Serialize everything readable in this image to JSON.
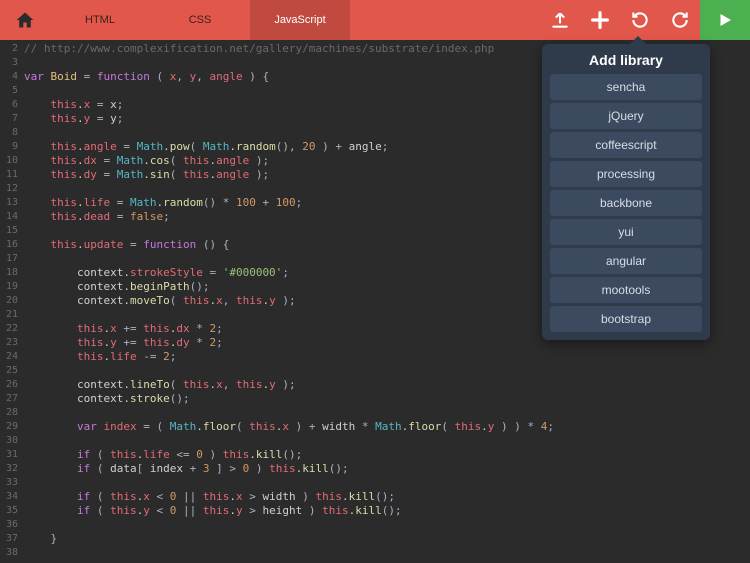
{
  "tabs": {
    "html": "HTML",
    "css": "CSS",
    "js": "JavaScript"
  },
  "popover": {
    "title": "Add library",
    "items": [
      "sencha",
      "jQuery",
      "coffeescript",
      "processing",
      "backbone",
      "yui",
      "angular",
      "mootools",
      "bootstrap"
    ]
  },
  "code": {
    "lines": [
      {
        "n": 2,
        "t": "comment",
        "text": "// http://www.complexification.net/gallery/machines/substrate/index.php"
      },
      {
        "n": 3,
        "t": "blank"
      },
      {
        "n": 4,
        "t": "raw",
        "html": "<span class='c-kw'>var</span> <span class='c-class'>Boid</span> <span class='c-op'>=</span> <span class='c-kw'>function</span> <span class='c-paren'>(</span> <span class='c-prop'>x</span><span class='c-paren'>,</span> <span class='c-prop'>y</span><span class='c-paren'>,</span> <span class='c-prop'>angle</span> <span class='c-paren'>) {</span>"
      },
      {
        "n": 5,
        "t": "blank"
      },
      {
        "n": 6,
        "t": "raw",
        "html": "    <span class='c-this'>this</span>.<span class='c-prop'>x</span> <span class='c-op'>=</span> x<span class='c-paren'>;</span>"
      },
      {
        "n": 7,
        "t": "raw",
        "html": "    <span class='c-this'>this</span>.<span class='c-prop'>y</span> <span class='c-op'>=</span> y<span class='c-paren'>;</span>"
      },
      {
        "n": 8,
        "t": "blank"
      },
      {
        "n": 9,
        "t": "raw",
        "html": "    <span class='c-this'>this</span>.<span class='c-prop'>angle</span> <span class='c-op'>=</span> <span class='c-obj'>Math</span>.<span class='c-func'>pow</span><span class='c-paren'>(</span> <span class='c-obj'>Math</span>.<span class='c-func'>random</span><span class='c-paren'>()</span><span class='c-paren'>,</span> <span class='c-num'>20</span> <span class='c-paren'>)</span> <span class='c-op'>+</span> angle<span class='c-paren'>;</span>"
      },
      {
        "n": 10,
        "t": "raw",
        "html": "    <span class='c-this'>this</span>.<span class='c-prop'>dx</span> <span class='c-op'>=</span> <span class='c-obj'>Math</span>.<span class='c-func'>cos</span><span class='c-paren'>(</span> <span class='c-this'>this</span>.<span class='c-prop'>angle</span> <span class='c-paren'>);</span>"
      },
      {
        "n": 11,
        "t": "raw",
        "html": "    <span class='c-this'>this</span>.<span class='c-prop'>dy</span> <span class='c-op'>=</span> <span class='c-obj'>Math</span>.<span class='c-func'>sin</span><span class='c-paren'>(</span> <span class='c-this'>this</span>.<span class='c-prop'>angle</span> <span class='c-paren'>);</span>"
      },
      {
        "n": 12,
        "t": "blank"
      },
      {
        "n": 13,
        "t": "raw",
        "html": "    <span class='c-this'>this</span>.<span class='c-prop'>life</span> <span class='c-op'>=</span> <span class='c-obj'>Math</span>.<span class='c-func'>random</span><span class='c-paren'>()</span> <span class='c-op'>*</span> <span class='c-num'>100</span> <span class='c-op'>+</span> <span class='c-num'>100</span><span class='c-paren'>;</span>"
      },
      {
        "n": 14,
        "t": "raw",
        "html": "    <span class='c-this'>this</span>.<span class='c-prop'>dead</span> <span class='c-op'>=</span> <span class='c-bool'>false</span><span class='c-paren'>;</span>"
      },
      {
        "n": 15,
        "t": "blank"
      },
      {
        "n": 16,
        "t": "raw",
        "html": "    <span class='c-this'>this</span>.<span class='c-prop'>update</span> <span class='c-op'>=</span> <span class='c-kw'>function</span> <span class='c-paren'>() {</span>"
      },
      {
        "n": 17,
        "t": "blank"
      },
      {
        "n": 18,
        "t": "raw",
        "html": "        context.<span class='c-prop'>strokeStyle</span> <span class='c-op'>=</span> <span class='c-str'>'#000000'</span><span class='c-paren'>;</span>"
      },
      {
        "n": 19,
        "t": "raw",
        "html": "        context.<span class='c-func'>beginPath</span><span class='c-paren'>();</span>"
      },
      {
        "n": 20,
        "t": "raw",
        "html": "        context.<span class='c-func'>moveTo</span><span class='c-paren'>(</span> <span class='c-this'>this</span>.<span class='c-prop'>x</span><span class='c-paren'>,</span> <span class='c-this'>this</span>.<span class='c-prop'>y</span> <span class='c-paren'>);</span>"
      },
      {
        "n": 21,
        "t": "blank"
      },
      {
        "n": 22,
        "t": "raw",
        "html": "        <span class='c-this'>this</span>.<span class='c-prop'>x</span> <span class='c-op'>+=</span> <span class='c-this'>this</span>.<span class='c-prop'>dx</span> <span class='c-op'>*</span> <span class='c-num'>2</span><span class='c-paren'>;</span>"
      },
      {
        "n": 23,
        "t": "raw",
        "html": "        <span class='c-this'>this</span>.<span class='c-prop'>y</span> <span class='c-op'>+=</span> <span class='c-this'>this</span>.<span class='c-prop'>dy</span> <span class='c-op'>*</span> <span class='c-num'>2</span><span class='c-paren'>;</span>"
      },
      {
        "n": 24,
        "t": "raw",
        "html": "        <span class='c-this'>this</span>.<span class='c-prop'>life</span> <span class='c-op'>-=</span> <span class='c-num'>2</span><span class='c-paren'>;</span>"
      },
      {
        "n": 25,
        "t": "blank"
      },
      {
        "n": 26,
        "t": "raw",
        "html": "        context.<span class='c-func'>lineTo</span><span class='c-paren'>(</span> <span class='c-this'>this</span>.<span class='c-prop'>x</span><span class='c-paren'>,</span> <span class='c-this'>this</span>.<span class='c-prop'>y</span> <span class='c-paren'>);</span>"
      },
      {
        "n": 27,
        "t": "raw",
        "html": "        context.<span class='c-func'>stroke</span><span class='c-paren'>();</span>"
      },
      {
        "n": 28,
        "t": "blank"
      },
      {
        "n": 29,
        "t": "raw",
        "html": "        <span class='c-kw'>var</span> <span class='c-prop'>index</span> <span class='c-op'>=</span> <span class='c-paren'>(</span> <span class='c-obj'>Math</span>.<span class='c-func'>floor</span><span class='c-paren'>(</span> <span class='c-this'>this</span>.<span class='c-prop'>x</span> <span class='c-paren'>)</span> <span class='c-op'>+</span> width <span class='c-op'>*</span> <span class='c-obj'>Math</span>.<span class='c-func'>floor</span><span class='c-paren'>(</span> <span class='c-this'>this</span>.<span class='c-prop'>y</span> <span class='c-paren'>) )</span> <span class='c-op'>*</span> <span class='c-num'>4</span><span class='c-paren'>;</span>"
      },
      {
        "n": 30,
        "t": "blank"
      },
      {
        "n": 31,
        "t": "raw",
        "html": "        <span class='c-kw'>if</span> <span class='c-paren'>(</span> <span class='c-this'>this</span>.<span class='c-prop'>life</span> <span class='c-op'>&lt;=</span> <span class='c-num'>0</span> <span class='c-paren'>)</span> <span class='c-this'>this</span>.<span class='c-func'>kill</span><span class='c-paren'>();</span>"
      },
      {
        "n": 32,
        "t": "raw",
        "html": "        <span class='c-kw'>if</span> <span class='c-paren'>(</span> data<span class='c-paren'>[</span> index <span class='c-op'>+</span> <span class='c-num'>3</span> <span class='c-paren'>]</span> <span class='c-op'>&gt;</span> <span class='c-num'>0</span> <span class='c-paren'>)</span> <span class='c-this'>this</span>.<span class='c-func'>kill</span><span class='c-paren'>();</span>"
      },
      {
        "n": 33,
        "t": "blank"
      },
      {
        "n": 34,
        "t": "raw",
        "html": "        <span class='c-kw'>if</span> <span class='c-paren'>(</span> <span class='c-this'>this</span>.<span class='c-prop'>x</span> <span class='c-op'>&lt;</span> <span class='c-num'>0</span> <span class='c-op'>||</span> <span class='c-this'>this</span>.<span class='c-prop'>x</span> <span class='c-op'>&gt;</span> width <span class='c-paren'>)</span> <span class='c-this'>this</span>.<span class='c-func'>kill</span><span class='c-paren'>();</span>"
      },
      {
        "n": 35,
        "t": "raw",
        "html": "        <span class='c-kw'>if</span> <span class='c-paren'>(</span> <span class='c-this'>this</span>.<span class='c-prop'>y</span> <span class='c-op'>&lt;</span> <span class='c-num'>0</span> <span class='c-op'>||</span> <span class='c-this'>this</span>.<span class='c-prop'>y</span> <span class='c-op'>&gt;</span> height <span class='c-paren'>)</span> <span class='c-this'>this</span>.<span class='c-func'>kill</span><span class='c-paren'>();</span>"
      },
      {
        "n": 36,
        "t": "blank"
      },
      {
        "n": 37,
        "t": "raw",
        "html": "    <span class='c-paren'>}</span>"
      },
      {
        "n": 38,
        "t": "blank"
      }
    ]
  }
}
